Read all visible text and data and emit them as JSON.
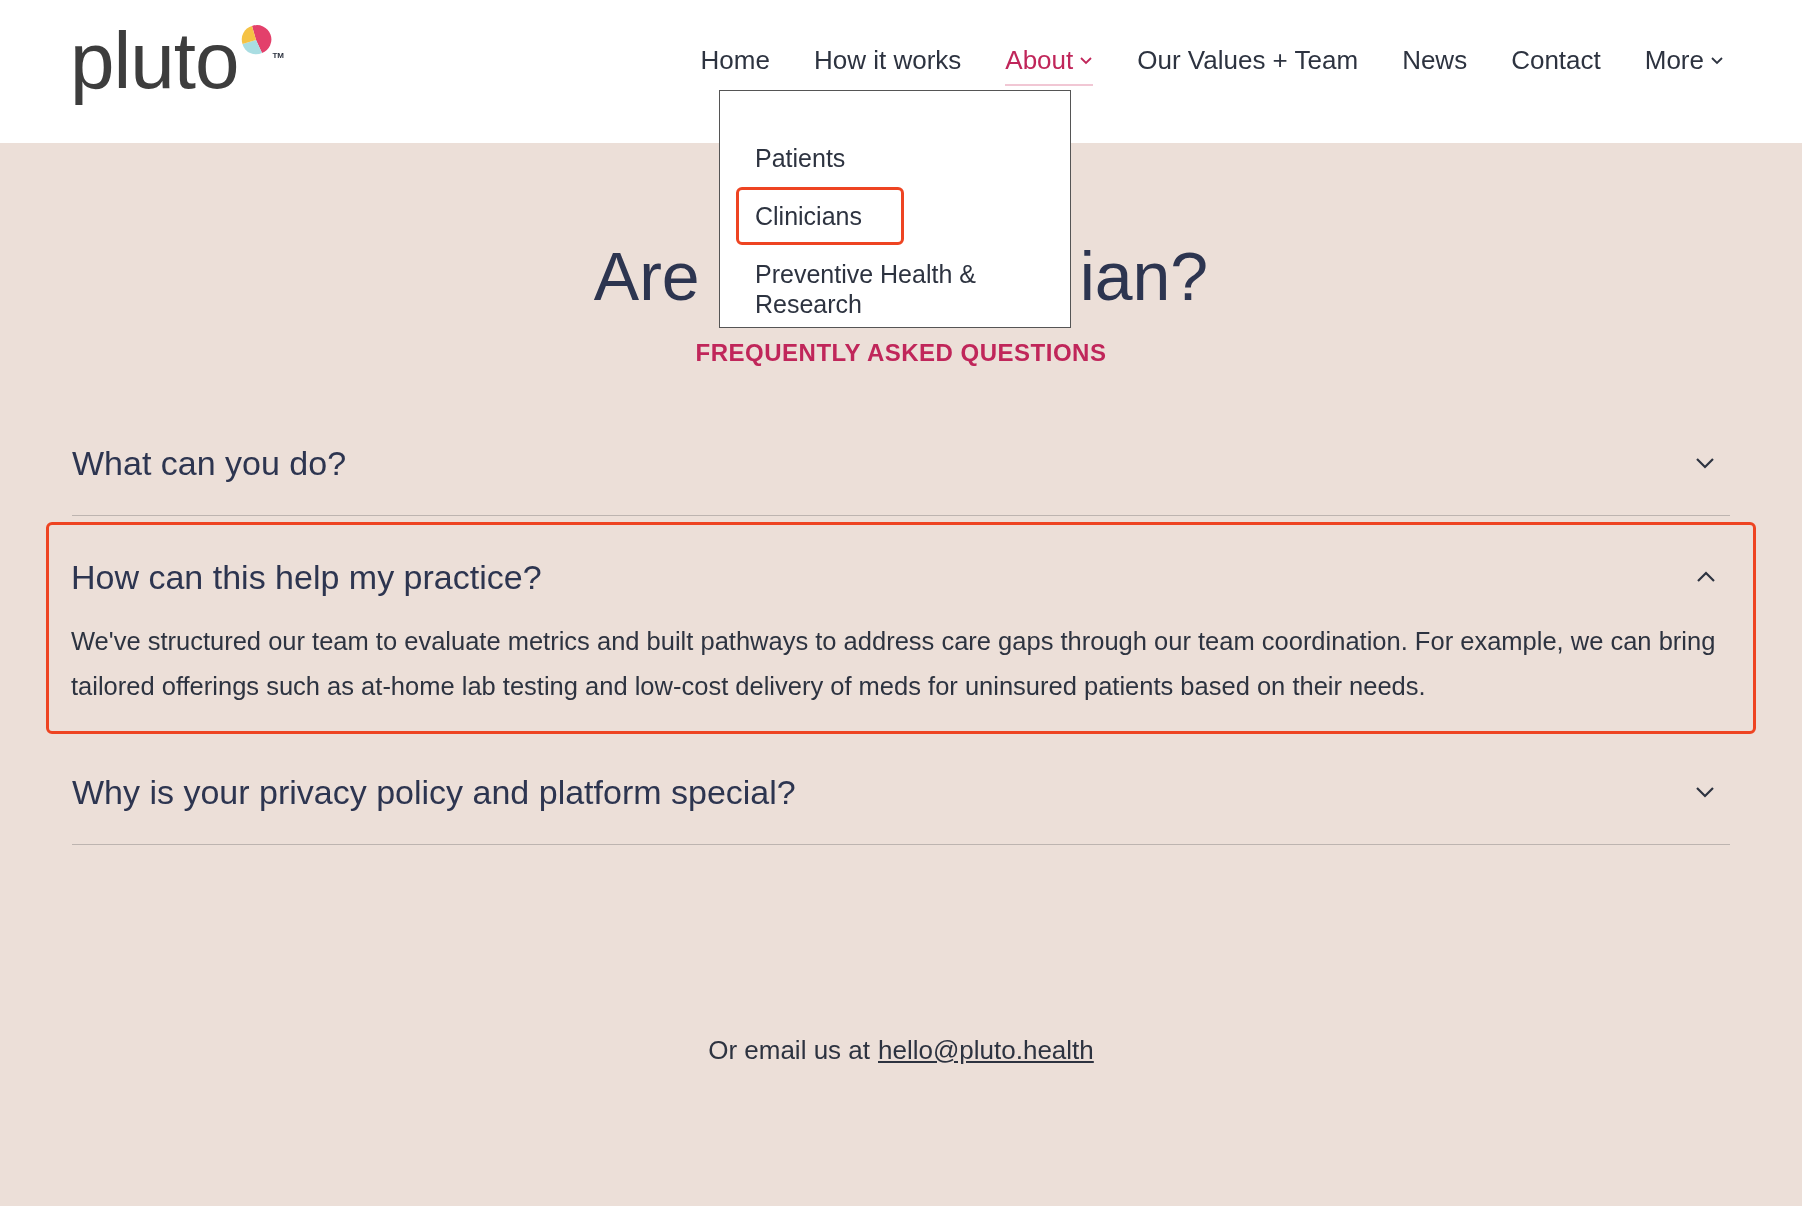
{
  "header": {
    "logo": "pluto",
    "trademark": "TM"
  },
  "nav": [
    {
      "label": "Home",
      "selected": false,
      "dropdown": false
    },
    {
      "label": "How it works",
      "selected": false,
      "dropdown": false
    },
    {
      "label": "About",
      "selected": true,
      "dropdown": true
    },
    {
      "label": "Our Values + Team",
      "selected": false,
      "dropdown": false
    },
    {
      "label": "News",
      "selected": false,
      "dropdown": false
    },
    {
      "label": "Contact",
      "selected": false,
      "dropdown": false
    },
    {
      "label": "More",
      "selected": false,
      "dropdown": true
    }
  ],
  "dropdown_menu": [
    {
      "label": "Patients",
      "highlighted": false
    },
    {
      "label": "Clinicians",
      "highlighted": true
    },
    {
      "label": "Preventive Health & Research",
      "highlighted": false
    }
  ],
  "heading_visible_parts": [
    "Are",
    "ian?"
  ],
  "eyebrow": "FREQUENTLY ASKED QUESTIONS",
  "faq": [
    {
      "question": "What can you do?",
      "expanded": false,
      "highlighted": false
    },
    {
      "question": "How can this help my practice?",
      "expanded": true,
      "highlighted": true,
      "answer": "We've structured our team to evaluate metrics and built pathways to address care gaps through our team coordination. For example, we can bring tailored offerings such as at-home lab testing and low-cost delivery of meds for uninsured patients based on their needs."
    },
    {
      "question": "Why is your privacy policy and platform special?",
      "expanded": false,
      "highlighted": false
    }
  ],
  "contact": {
    "text": "Or email us at",
    "email": "hello@pluto.health"
  }
}
